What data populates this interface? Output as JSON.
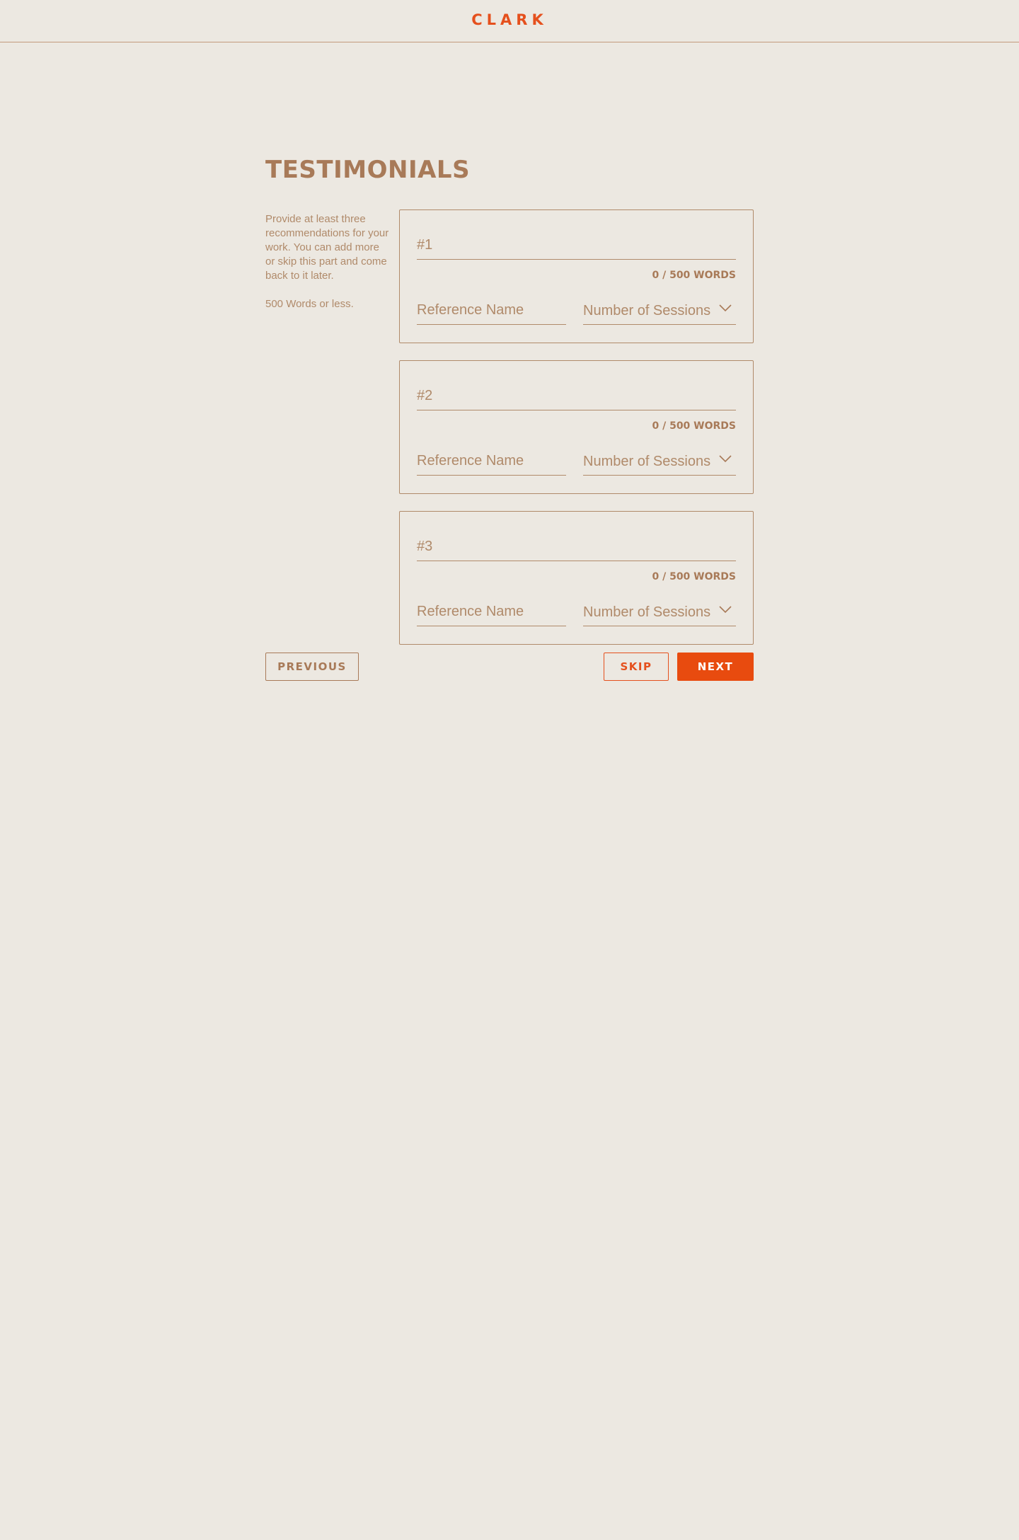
{
  "header": {
    "logo": "CLARK"
  },
  "page": {
    "title": "TESTIMONIALS",
    "instructions": "Provide at least three recommendations for your work. You can add more or skip this part and come back to it later.",
    "word_limit_note": "500 Words or less."
  },
  "testimonials": [
    {
      "placeholder": "#1",
      "word_count": "0 / 500 WORDS",
      "reference_placeholder": "Reference Name",
      "sessions_label": "Number of Sessions"
    },
    {
      "placeholder": "#2",
      "word_count": "0 / 500 WORDS",
      "reference_placeholder": "Reference Name",
      "sessions_label": "Number of Sessions"
    },
    {
      "placeholder": "#3",
      "word_count": "0 / 500 WORDS",
      "reference_placeholder": "Reference Name",
      "sessions_label": "Number of Sessions"
    }
  ],
  "actions": {
    "previous_label": "PREVIOUS",
    "skip_label": "SKIP",
    "next_label": "NEXT"
  },
  "colors": {
    "background": "#ECE8E1",
    "text_brown": "#A87A58",
    "accent_orange": "#E84B0F"
  },
  "icons": {
    "dropdown": "chevron-down-icon"
  }
}
